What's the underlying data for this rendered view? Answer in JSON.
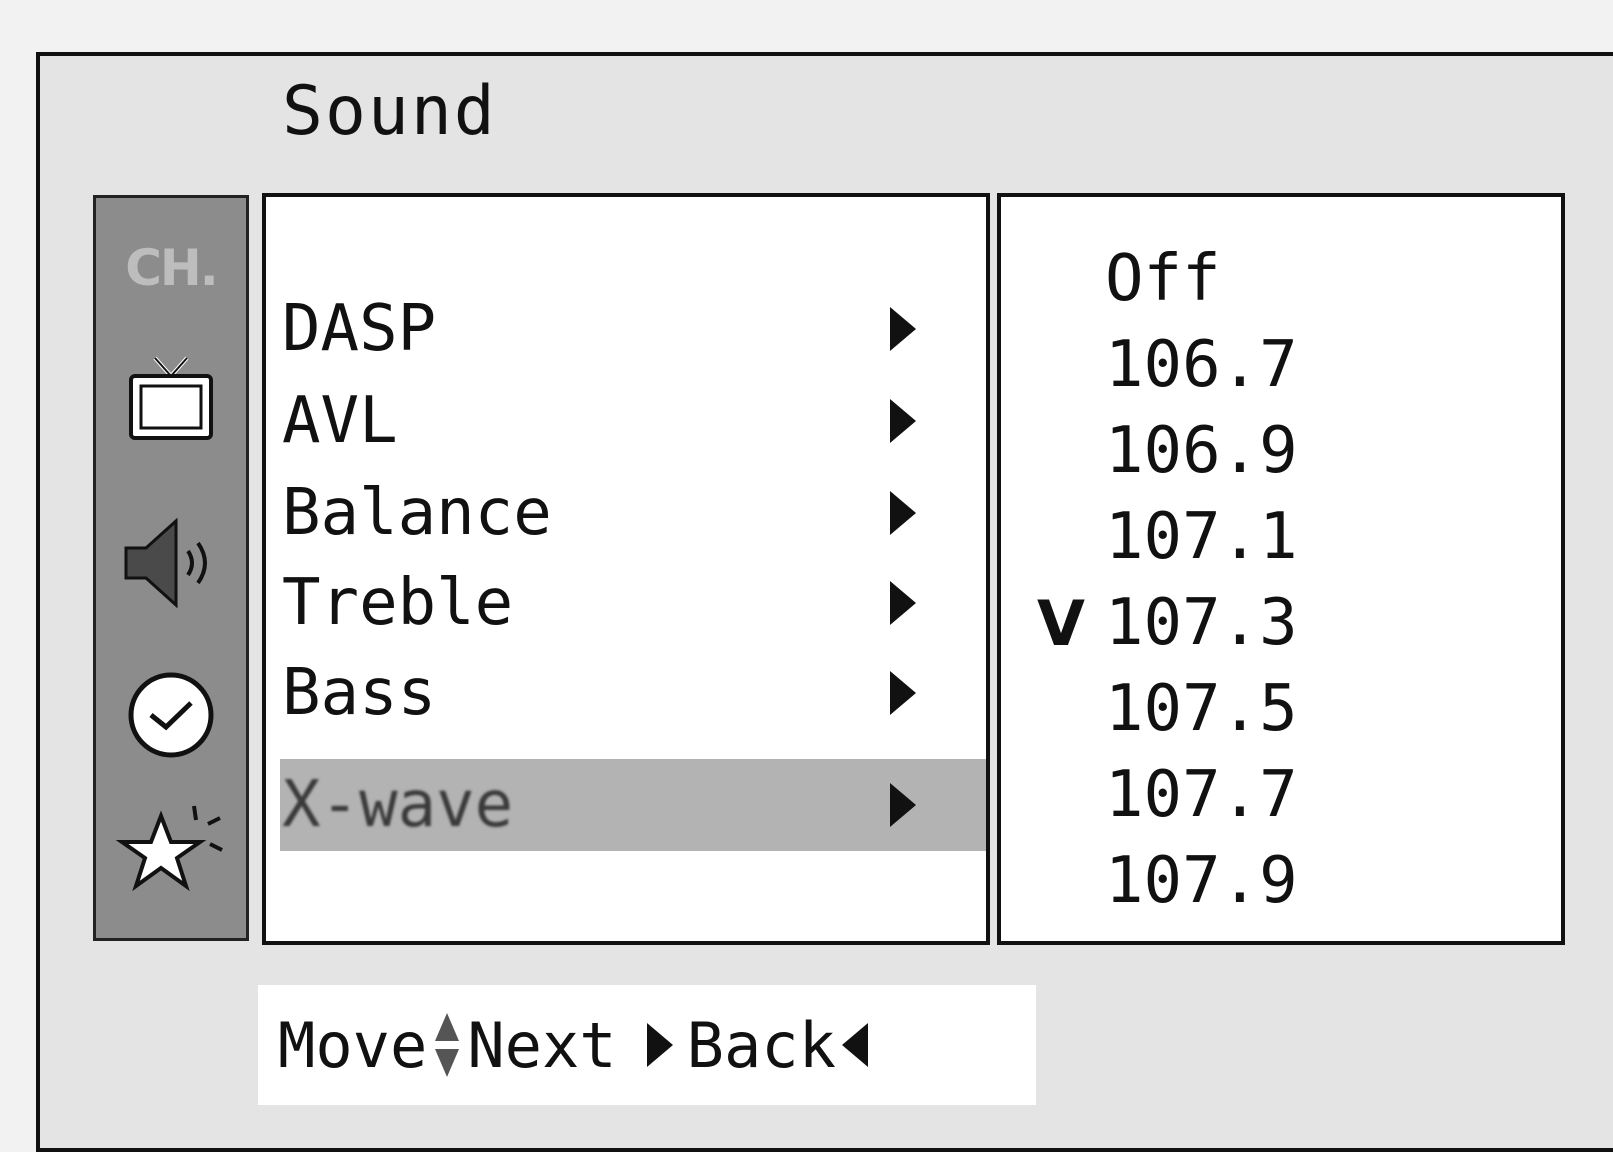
{
  "menu": {
    "title": "Sound",
    "sidebar": {
      "items": [
        {
          "icon": "ch-text-icon",
          "label": "CH."
        },
        {
          "icon": "tv-icon"
        },
        {
          "icon": "speaker-icon"
        },
        {
          "icon": "clock-icon"
        },
        {
          "icon": "star-icon"
        }
      ]
    },
    "items": [
      {
        "label": "DASP"
      },
      {
        "label": "AVL"
      },
      {
        "label": "Balance"
      },
      {
        "label": "Treble"
      },
      {
        "label": "Bass"
      },
      {
        "label": "X-wave",
        "selected": true
      }
    ],
    "submenu": {
      "options": [
        "Off",
        "106.7",
        "106.9",
        "107.1",
        "107.3",
        "107.5",
        "107.7",
        "107.9"
      ],
      "checked_mark": "V",
      "checked_option": "107.3"
    },
    "footer": {
      "move_label": "Move",
      "next_label": "Next",
      "back_label": "Back"
    }
  }
}
